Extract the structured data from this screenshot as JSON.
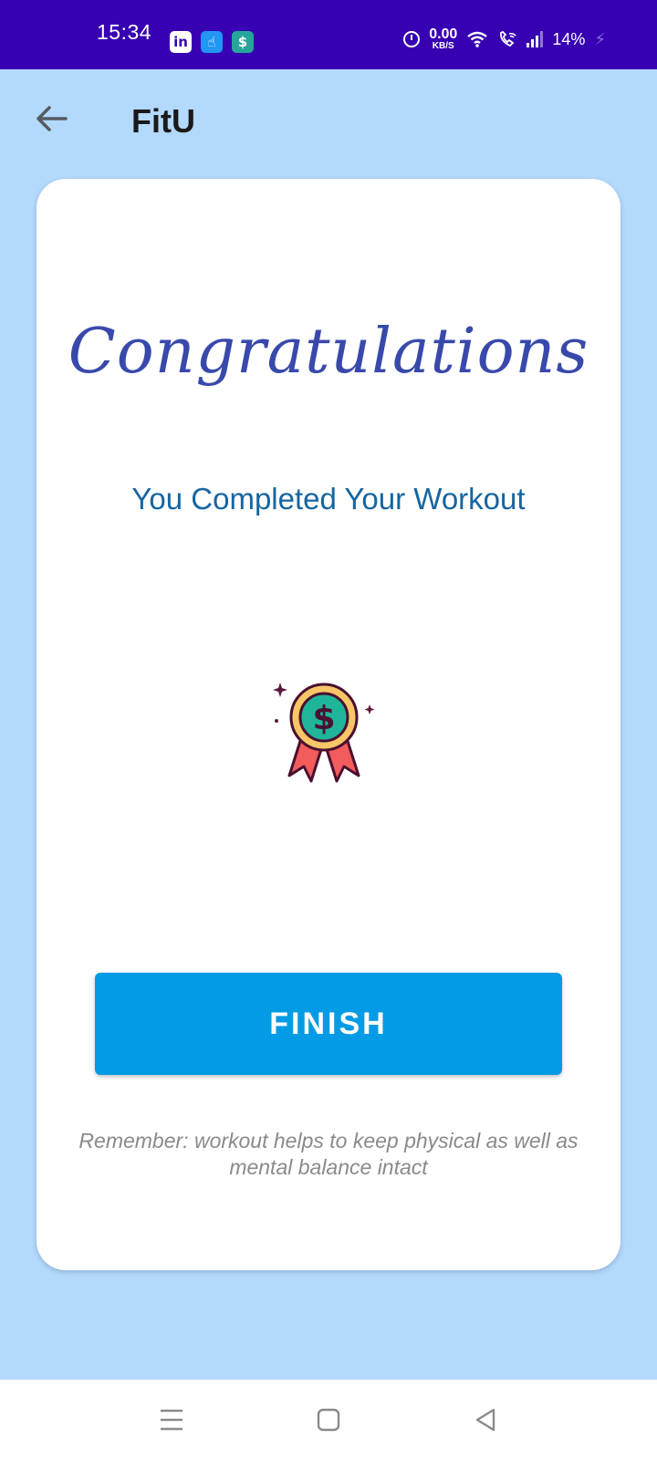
{
  "status_bar": {
    "time": "15:34",
    "app_icons": [
      "linkedin-icon",
      "touch-icon",
      "shield-icon"
    ],
    "net_speed_value": "0.00",
    "net_speed_unit": "KB/S",
    "battery": "14%",
    "colors": {
      "background": "#3700B3"
    }
  },
  "app_bar": {
    "title": "FitU",
    "back_icon": "arrow-left-icon"
  },
  "card": {
    "heading": "Congratulations",
    "subtitle": "You Completed Your Workout",
    "medal_icon": "medal-dollar-icon",
    "finish_label": "FINISH",
    "reminder": "Remember: workout helps to keep physical as well as mental balance intact"
  },
  "nav_bar": {
    "buttons": [
      "menu-icon",
      "home-square-icon",
      "back-triangle-icon"
    ]
  },
  "colors": {
    "page_background": "#B3D9FD",
    "heading": "#3949AB",
    "subtitle": "#1565A0",
    "button": "#039BE5"
  }
}
